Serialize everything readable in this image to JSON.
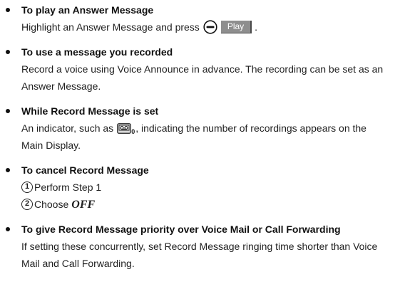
{
  "sections": [
    {
      "heading": "To play an Answer Message",
      "text_before_key": "Highlight an Answer Message and press",
      "key_icon": "center-minus-key-icon",
      "softkey_label": "Play",
      "text_after_key": "."
    },
    {
      "heading": "To use a message you recorded",
      "lines": [
        "Record a voice using Voice Announce in advance. The recording can be set as an",
        "Answer Message."
      ]
    },
    {
      "heading": "While Record Message is set",
      "text_before_icon": "An indicator, such as",
      "indicator_icon": "record-message-indicator-icon",
      "indicator_count": "0",
      "text_after_icon": ", indicating the number of recordings appears on the",
      "line2": "Main Display."
    },
    {
      "heading": "To cancel Record Message",
      "steps": [
        {
          "number": "1",
          "text": "Perform Step 1"
        },
        {
          "number": "2",
          "text": "Choose",
          "option": "OFF"
        }
      ]
    },
    {
      "heading": "To give Record Message priority over Voice Mail or Call Forwarding",
      "lines": [
        "If setting these concurrently, set Record Message ringing time shorter than Voice",
        "Mail and Call Forwarding."
      ]
    }
  ],
  "colors": {
    "text": "#1f1f1f",
    "softkey_bg": "#8e8e8e",
    "softkey_text": "#ffffff"
  }
}
